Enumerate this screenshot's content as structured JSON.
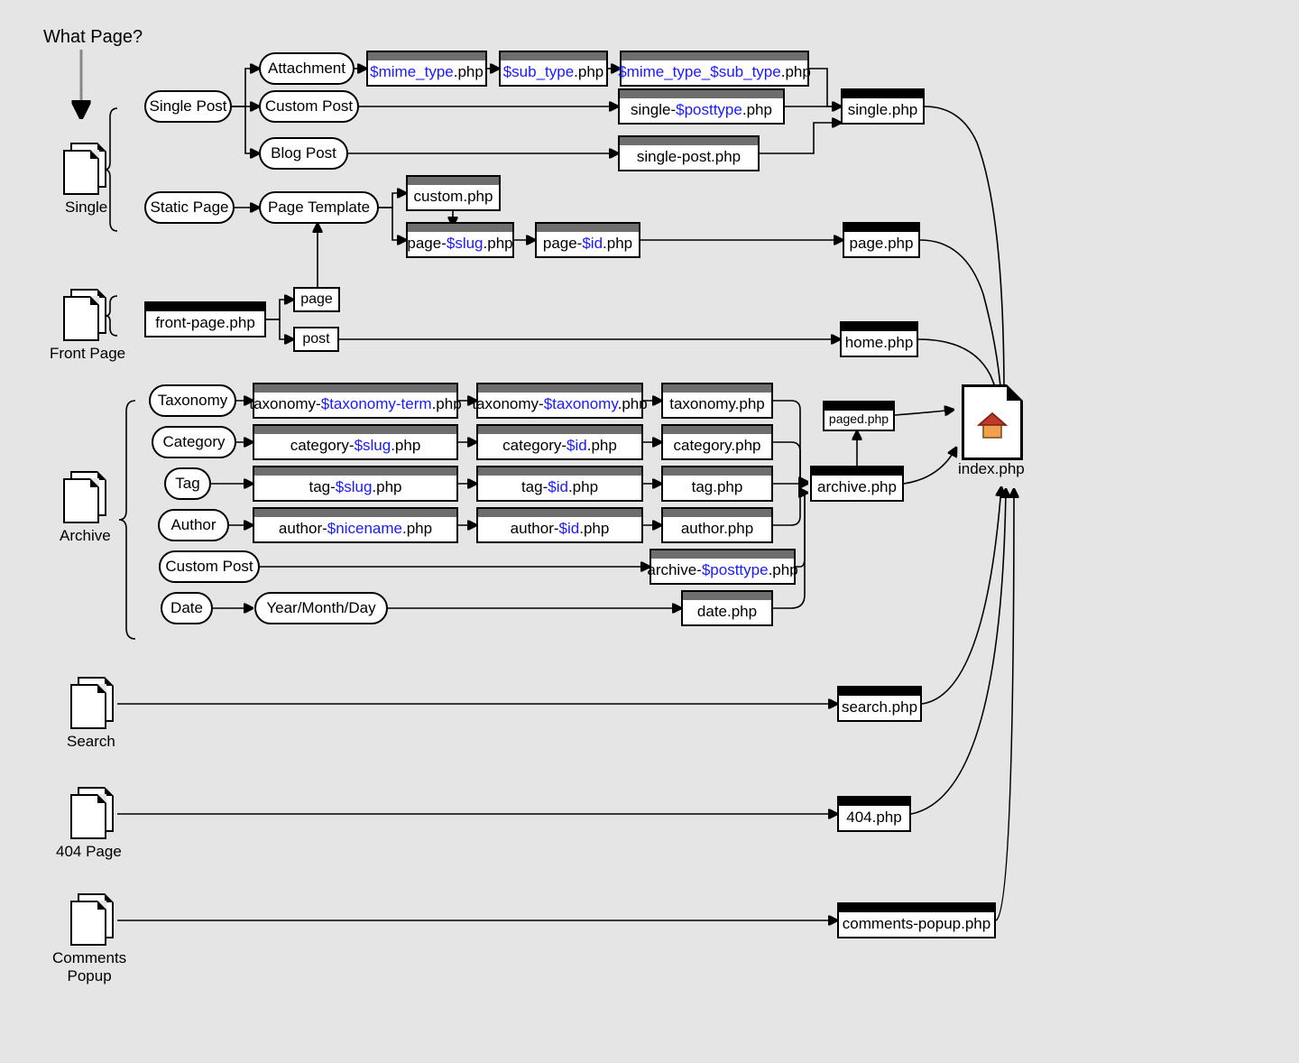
{
  "title": "What Page?",
  "sections": {
    "single": "Single",
    "frontpage": "Front Page",
    "archive": "Archive",
    "search": "Search",
    "fof": "404 Page",
    "comments": "Comments\nPopup"
  },
  "rboxes": {
    "single_post": "Single Post",
    "static_page": "Static Page",
    "attachment": "Attachment",
    "custom_post": "Custom Post",
    "blog_post": "Blog Post",
    "page_template": "Page Template",
    "taxonomy": "Taxonomy",
    "category": "Category",
    "tag": "Tag",
    "author": "Author",
    "custom_post2": "Custom Post",
    "date": "Date",
    "ymd": "Year/Month/Day"
  },
  "pboxes": {
    "page": "page",
    "post": "post"
  },
  "files": {
    "mime": {
      "pre": "",
      "var": "$mime_type",
      "post": ".php"
    },
    "sub": {
      "pre": "",
      "var": "$sub_type",
      "post": ".php"
    },
    "mimesub": {
      "pre": "",
      "var": "$mime_type_$sub_type",
      "post": ".php"
    },
    "single_pt": {
      "pre": "single-",
      "var": "$posttype",
      "post": ".php"
    },
    "single_post": {
      "pre": "single-post.php"
    },
    "single": {
      "pre": "single.php"
    },
    "custom": {
      "pre": "custom.php"
    },
    "page_slug": {
      "pre": "page-",
      "var": "$slug",
      "post": ".php"
    },
    "page_id": {
      "pre": "page-",
      "var": "$id",
      "post": ".php"
    },
    "page": {
      "pre": "page.php"
    },
    "frontpage": {
      "pre": "front-page.php"
    },
    "home": {
      "pre": "home.php"
    },
    "tax_tt": {
      "pre": "taxonomy-",
      "var": "$taxonomy-term",
      "post": ".php"
    },
    "tax_t": {
      "pre": "taxonomy-",
      "var": "$taxonomy",
      "post": ".php"
    },
    "tax": {
      "pre": "taxonomy.php"
    },
    "cat_slug": {
      "pre": "category-",
      "var": "$slug",
      "post": ".php"
    },
    "cat_id": {
      "pre": "category-",
      "var": "$id",
      "post": ".php"
    },
    "cat": {
      "pre": "category.php"
    },
    "tag_slug": {
      "pre": "tag-",
      "var": "$slug",
      "post": ".php"
    },
    "tag_id": {
      "pre": "tag-",
      "var": "$id",
      "post": ".php"
    },
    "tagf": {
      "pre": "tag.php"
    },
    "auth_nice": {
      "pre": "author-",
      "var": "$nicename",
      "post": ".php"
    },
    "auth_id": {
      "pre": "author-",
      "var": "$id",
      "post": ".php"
    },
    "auth": {
      "pre": "author.php"
    },
    "arch_pt": {
      "pre": "archive-",
      "var": "$posttype",
      "post": ".php"
    },
    "datef": {
      "pre": "date.php"
    },
    "archive": {
      "pre": "archive.php"
    },
    "paged": {
      "pre": "paged.php"
    },
    "search": {
      "pre": "search.php"
    },
    "fof": {
      "pre": "404.php"
    },
    "comments": {
      "pre": "comments-popup.php"
    },
    "index": {
      "pre": "index.php"
    }
  }
}
